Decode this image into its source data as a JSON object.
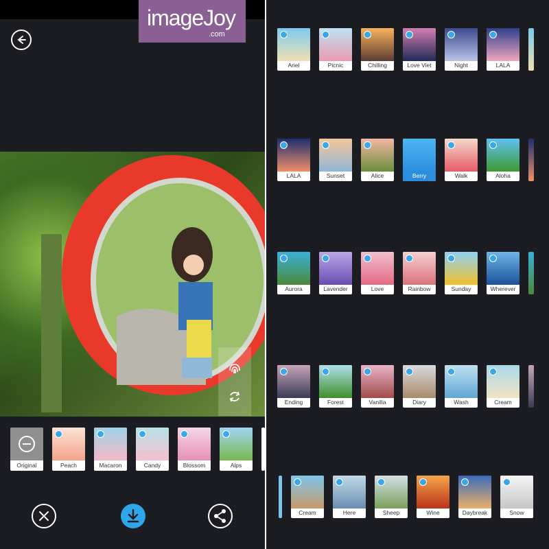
{
  "watermark": {
    "brand": "imageJoy",
    "domain": ".com"
  },
  "icons": {
    "back": "arrow-left-circle-icon",
    "fingerprint": "fingerprint-icon",
    "swap": "rotate-swap-icon",
    "cancel": "close-circle-icon",
    "download": "download-icon",
    "share": "share-icon",
    "cloud": "cloud-badge-icon",
    "minus": "minus-circle-icon"
  },
  "colors": {
    "accent": "#2fa6ea",
    "background": "#1c1d23",
    "watermark": "#8a5f93",
    "mirror_frame": "#e8392a"
  },
  "editor": {
    "filters": [
      {
        "label": "Original",
        "selected": true
      },
      {
        "label": "Peach"
      },
      {
        "label": "Macaron"
      },
      {
        "label": "Candy"
      },
      {
        "label": "Blossom"
      },
      {
        "label": "Alps"
      }
    ]
  },
  "gallery": {
    "rows": [
      [
        "Ariel",
        "Picnic",
        "Chilling",
        "Love Viet",
        "Night",
        "LALA"
      ],
      [
        "LALA",
        "Sunset",
        "Alice",
        "Berry",
        "Walk",
        "Aloha"
      ],
      [
        "Aurora",
        "Lavender",
        "Love",
        "Rainbow",
        "Sunday",
        "Wherever"
      ],
      [
        "Ending",
        "Forest",
        "Vanilla",
        "Diary",
        "Wash",
        "Cream"
      ],
      [
        "Cream",
        "Here",
        "Sheep",
        "Wine",
        "Daybreak",
        "Snow"
      ]
    ]
  }
}
